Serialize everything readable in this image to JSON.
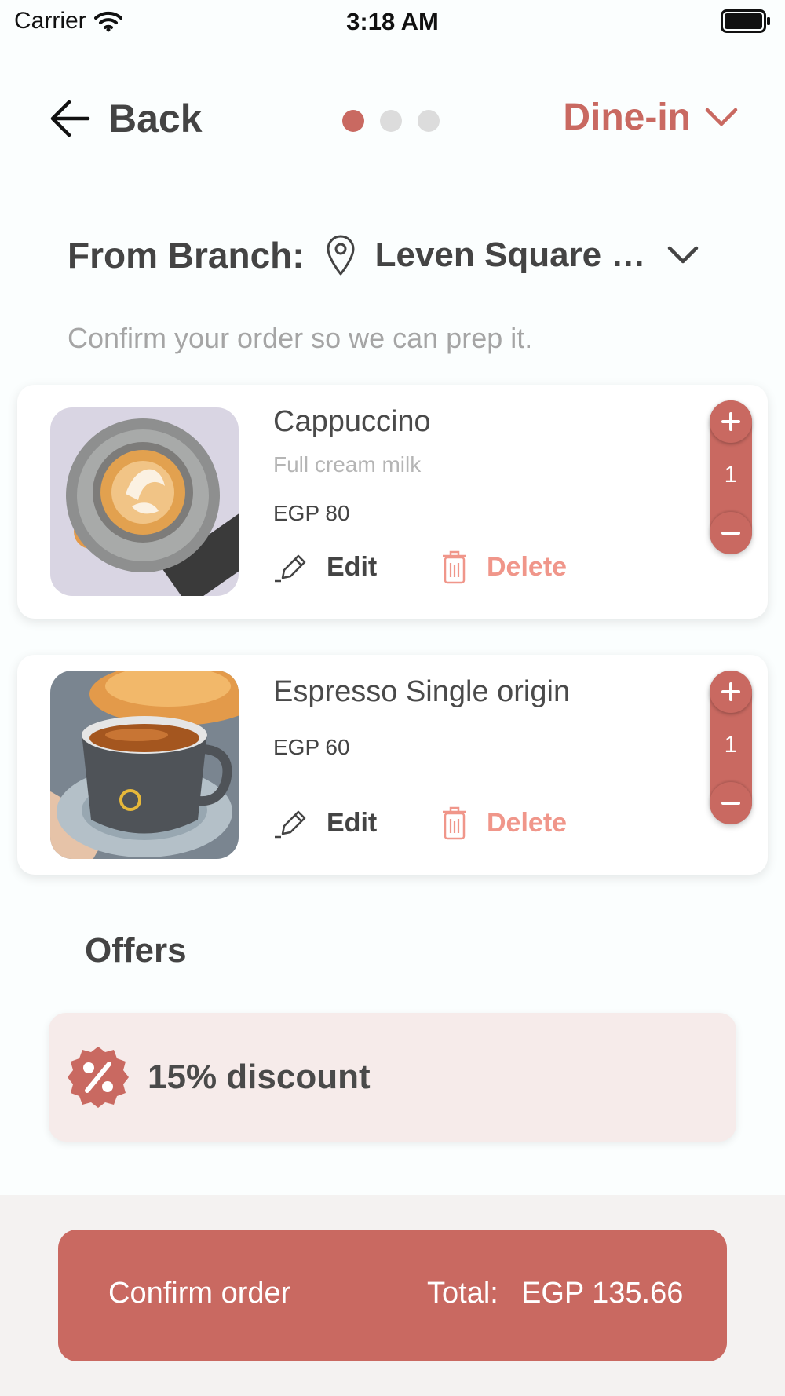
{
  "status_bar": {
    "carrier": "Carrier",
    "time": "3:18 AM"
  },
  "nav": {
    "back_label": "Back",
    "steps_total": 3,
    "active_step": 1,
    "order_type": "Dine-in"
  },
  "branch": {
    "label": "From Branch:",
    "name": "Leven Square …"
  },
  "subtitle": "Confirm your order so we can prep it.",
  "items": [
    {
      "name": "Cappuccino",
      "description": "Full cream milk",
      "price": "EGP 80",
      "edit_label": "Edit",
      "delete_label": "Delete",
      "quantity": "1"
    },
    {
      "name": "Espresso Single origin",
      "price": "EGP 60",
      "edit_label": "Edit",
      "delete_label": "Delete",
      "quantity": "1"
    }
  ],
  "offers": {
    "title": "Offers",
    "items": [
      {
        "label": "15% discount"
      }
    ]
  },
  "footer": {
    "confirm_label": "Confirm order",
    "total_label": "Total:",
    "total_value": "EGP 135.66"
  },
  "colors": {
    "accent": "#c96961",
    "delete": "#f0968a",
    "offer_bg": "#f6ebea"
  }
}
